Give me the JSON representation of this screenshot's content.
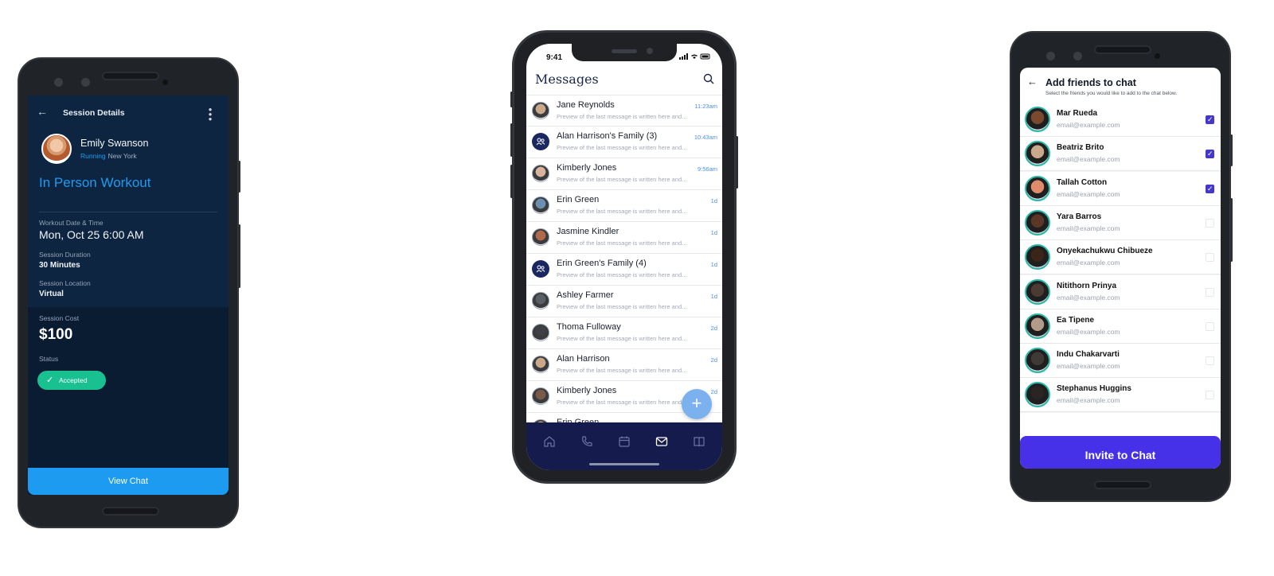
{
  "session": {
    "header_title": "Session Details",
    "client_name": "Emily Swanson",
    "activity": "Running",
    "location_city": "New York",
    "workout_type": "In Person Workout",
    "fields": [
      {
        "label": "Workout Date & Time",
        "value": "Mon, Oct 25 6:00 AM"
      },
      {
        "label": "Session Duration",
        "value": "30 Minutes"
      },
      {
        "label": "Session Location",
        "value": "Virtual"
      }
    ],
    "cost_label": "Session Cost",
    "cost_value": "$100",
    "status_label": "Status",
    "status_value": "Accepted",
    "view_chat_label": "View Chat",
    "accent_color": "#1c9bf0",
    "status_color": "#19c191"
  },
  "messages": {
    "status_time": "9:41",
    "title": "Messages",
    "preview_text": "Preview of the last message is written here and...",
    "conversations": [
      {
        "name": "Jane Reynolds",
        "time": "11:23am",
        "group": false
      },
      {
        "name": "Alan Harrison's Family (3)",
        "time": "10:43am",
        "group": true
      },
      {
        "name": "Kimberly Jones",
        "time": "9:56am",
        "group": false
      },
      {
        "name": "Erin Green",
        "time": "1d",
        "group": false
      },
      {
        "name": "Jasmine Kindler",
        "time": "1d",
        "group": false
      },
      {
        "name": "Erin Green's Family (4)",
        "time": "1d",
        "group": true
      },
      {
        "name": "Ashley Farmer",
        "time": "1d",
        "group": false
      },
      {
        "name": "Thoma Fulloway",
        "time": "2d",
        "group": false
      },
      {
        "name": "Alan Harrison",
        "time": "2d",
        "group": false
      },
      {
        "name": "Kimberly Jones",
        "time": "2d",
        "group": false
      },
      {
        "name": "Erin Green",
        "time": "",
        "group": false
      }
    ],
    "nav_icons": [
      "home-icon",
      "phone-icon",
      "calendar-icon",
      "mail-icon",
      "book-icon"
    ],
    "nav_color": "#151b4d"
  },
  "invite": {
    "title": "Add friends to chat",
    "subtitle": "Select the friends you would like to add to the chat below.",
    "friends": [
      {
        "name": "Mar Rueda",
        "email": "email@example.com",
        "checked": true
      },
      {
        "name": "Beatriz Brito",
        "email": "email@example.com",
        "checked": true
      },
      {
        "name": "Tallah Cotton",
        "email": "email@example.com",
        "checked": true
      },
      {
        "name": "Yara Barros",
        "email": "email@example.com",
        "checked": false
      },
      {
        "name": "Onyekachukwu Chibueze",
        "email": "email@example.com",
        "checked": false
      },
      {
        "name": "Nitithorn Prinya",
        "email": "email@example.com",
        "checked": false
      },
      {
        "name": "Ea Tipene",
        "email": "email@example.com",
        "checked": false
      },
      {
        "name": "Indu Chakarvarti",
        "email": "email@example.com",
        "checked": false
      },
      {
        "name": "Stephanus Huggins",
        "email": "email@example.com",
        "checked": false
      }
    ],
    "invite_label": "Invite to Chat",
    "accent_color": "#4631e8"
  }
}
